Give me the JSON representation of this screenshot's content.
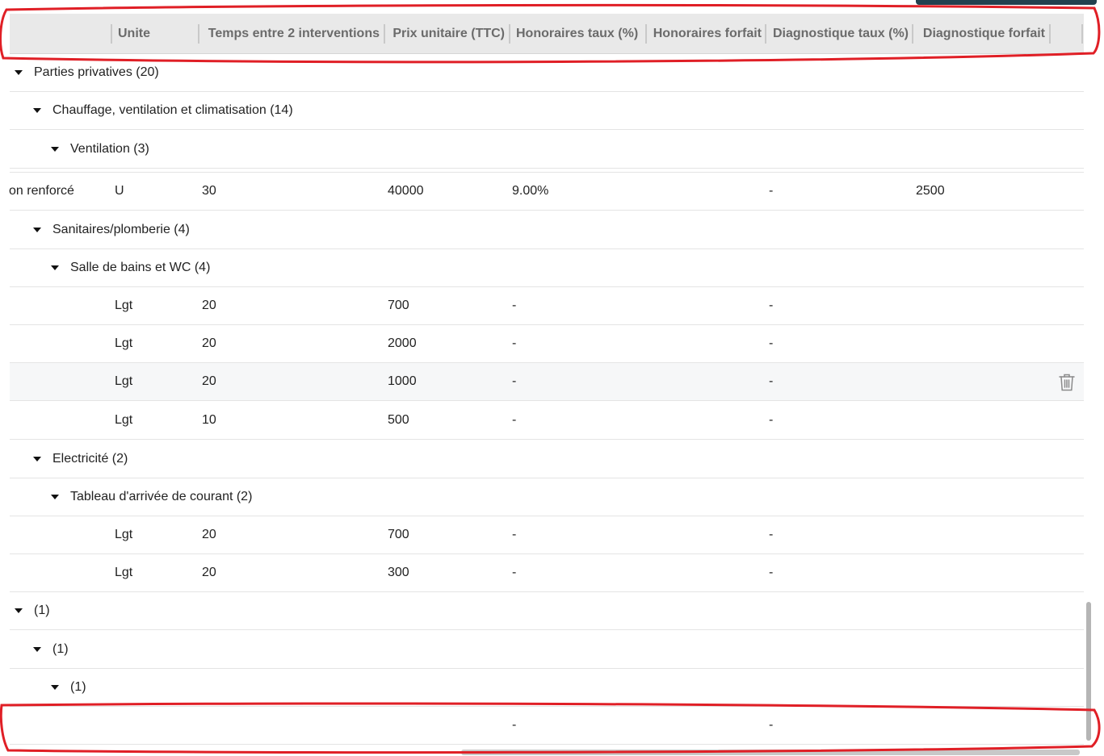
{
  "header": {
    "columns": [
      {
        "label": ""
      },
      {
        "label": "Unite"
      },
      {
        "label": "Temps entre 2 interventions"
      },
      {
        "label": "Prix unitaire (TTC)"
      },
      {
        "label": "Honoraires taux (%)"
      },
      {
        "label": "Honoraires forfait"
      },
      {
        "label": "Diagnostique taux (%)"
      },
      {
        "label": "Diagnostique forfait"
      }
    ]
  },
  "rows": [
    {
      "type": "group",
      "label": "Parties privatives (20)"
    },
    {
      "type": "group",
      "label": "Chauffage, ventilation et climatisation (14)"
    },
    {
      "type": "group",
      "label": "Ventilation (3)"
    },
    {
      "type": "data",
      "name": "on renforcé",
      "unite": "U",
      "temps": "30",
      "prix": "40000",
      "hon_taux": "9.00%",
      "hon_forfait": "-",
      "diag_taux": "2500",
      "diag_forfait": ""
    },
    {
      "type": "group",
      "label": "Sanitaires/plomberie (4)"
    },
    {
      "type": "group",
      "label": "Salle de bains et WC (4)"
    },
    {
      "type": "data",
      "name": "",
      "unite": "Lgt",
      "temps": "20",
      "prix": "700",
      "hon_taux": "-",
      "hon_forfait": "-",
      "diag_taux": "",
      "diag_forfait": ""
    },
    {
      "type": "data",
      "name": "",
      "unite": "Lgt",
      "temps": "20",
      "prix": "2000",
      "hon_taux": "-",
      "hon_forfait": "-",
      "diag_taux": "",
      "diag_forfait": ""
    },
    {
      "type": "data",
      "name": "",
      "unite": "Lgt",
      "temps": "20",
      "prix": "1000",
      "hon_taux": "-",
      "hon_forfait": "-",
      "diag_taux": "",
      "diag_forfait": ""
    },
    {
      "type": "data",
      "name": "",
      "unite": "Lgt",
      "temps": "10",
      "prix": "500",
      "hon_taux": "-",
      "hon_forfait": "-",
      "diag_taux": "",
      "diag_forfait": ""
    },
    {
      "type": "group",
      "label": "Electricité (2)"
    },
    {
      "type": "group",
      "label": "Tableau d'arrivée de courant (2)"
    },
    {
      "type": "data",
      "name": "",
      "unite": "Lgt",
      "temps": "20",
      "prix": "700",
      "hon_taux": "-",
      "hon_forfait": "-",
      "diag_taux": "",
      "diag_forfait": ""
    },
    {
      "type": "data",
      "name": "",
      "unite": "Lgt",
      "temps": "20",
      "prix": "300",
      "hon_taux": "-",
      "hon_forfait": "-",
      "diag_taux": "",
      "diag_forfait": ""
    },
    {
      "type": "group",
      "label": "(1)"
    },
    {
      "type": "group",
      "label": "(1)"
    },
    {
      "type": "group",
      "label": "(1)"
    },
    {
      "type": "data",
      "name": "",
      "unite": "",
      "temps": "",
      "prix": "",
      "hon_taux": "-",
      "hon_forfait": "-",
      "diag_taux": "",
      "diag_forfait": ""
    }
  ],
  "icons": {
    "row_action": "trash-icon",
    "expand": "caret-down-icon"
  },
  "colors": {
    "annotation": "#e01f26",
    "header_bg": "#e9e9e9",
    "top_bar": "#22414f"
  }
}
